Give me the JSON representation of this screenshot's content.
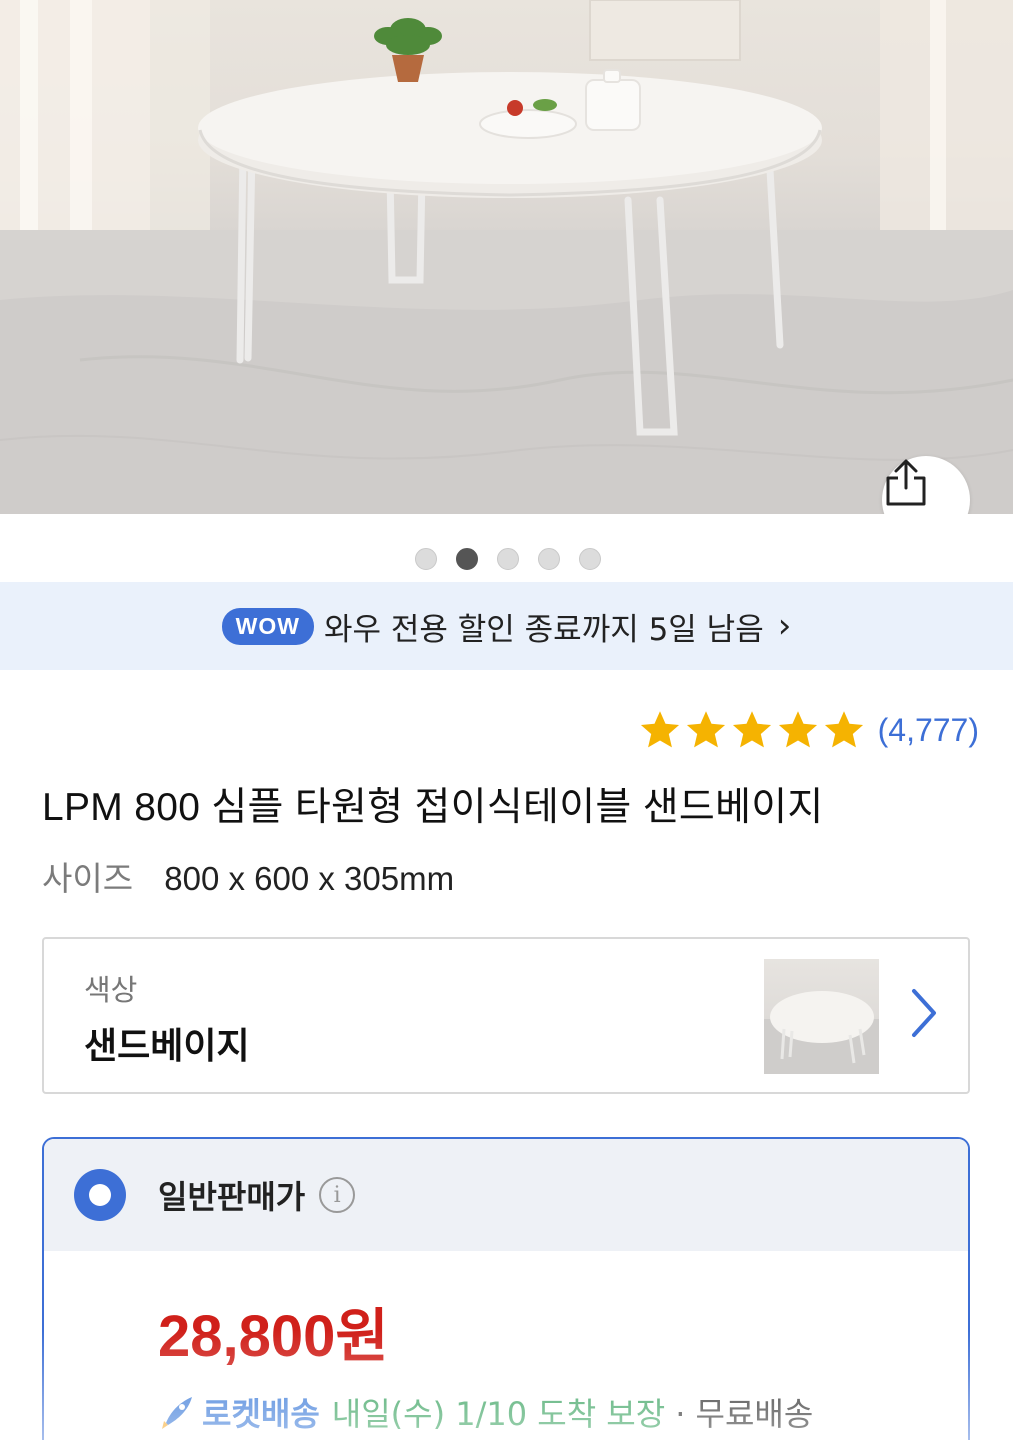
{
  "product_image": {
    "alt": "",
    "carousel": {
      "total": 5,
      "active_index": 1
    }
  },
  "share": {
    "icon": "share-icon"
  },
  "wow_banner": {
    "badge": "WOW",
    "text": "와우 전용 할인 종료까지 5일 남음",
    "chevron": "›"
  },
  "rating": {
    "stars": 5,
    "count": "(4,777)",
    "star_color": "#f5b301"
  },
  "product": {
    "title": "LPM 800 심플 타원형 접이식테이블 샌드베이지",
    "size_label": "사이즈",
    "size_value": "800 x 600 x 305mm"
  },
  "color_option": {
    "label": "색상",
    "value": "샌드베이지"
  },
  "price_option": {
    "label": "일반판매가",
    "info": "i",
    "price": "28,800원",
    "delivery": {
      "badge": "로켓배송",
      "date": "내일(수) 1/10 도착 보장",
      "separator_free": "· 무료배송"
    }
  },
  "colors": {
    "accent": "#3d6fd6",
    "price": "#d0201a",
    "delivery_green": "#2c9c55",
    "banner_bg": "#eaf1fb"
  }
}
